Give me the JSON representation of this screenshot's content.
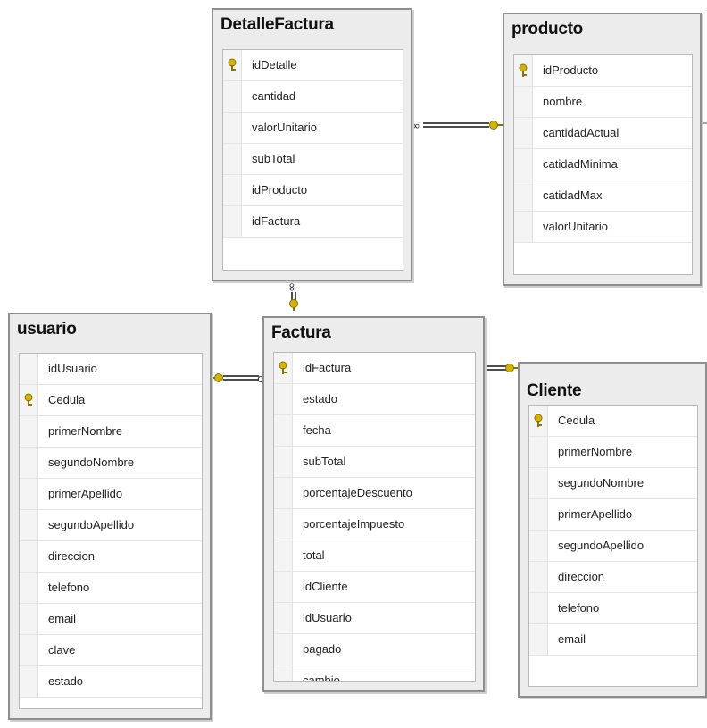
{
  "tables": {
    "detalle": {
      "title": "DetalleFactura",
      "columns": [
        "idDetalle",
        "cantidad",
        "valorUnitario",
        "subTotal",
        "idProducto",
        "idFactura"
      ],
      "pk": [
        0
      ]
    },
    "producto": {
      "title": "producto",
      "columns": [
        "idProducto",
        "nombre",
        "cantidadActual",
        "catidadMinima",
        "catidadMax",
        "valorUnitario"
      ],
      "pk": [
        0
      ]
    },
    "usuario": {
      "title": "usuario",
      "columns": [
        "idUsuario",
        "Cedula",
        "primerNombre",
        "segundoNombre",
        "primerApellido",
        "segundoApellido",
        "direccion",
        "telefono",
        "email",
        "clave",
        "estado"
      ],
      "pk": [
        1
      ]
    },
    "factura": {
      "title": "Factura",
      "columns": [
        "idFactura",
        "estado",
        "fecha",
        "subTotal",
        "porcentajeDescuento",
        "porcentajeImpuesto",
        "total",
        "idCliente",
        "idUsuario",
        "pagado",
        "cambio"
      ],
      "pk": [
        0
      ]
    },
    "cliente": {
      "title": "Cliente",
      "columns": [
        "Cedula",
        "primerNombre",
        "segundoNombre",
        "primerApellido",
        "segundoApellido",
        "direccion",
        "telefono",
        "email"
      ],
      "pk": [
        0
      ]
    }
  },
  "colors": {
    "key": "#d4b400",
    "line": "#4d4d4d",
    "header_bg": "#ececec",
    "border": "#8e8e8e"
  },
  "icons": {
    "primary_key": "key-icon",
    "relationship_one": "key-icon",
    "relationship_many": "infinity-icon"
  }
}
